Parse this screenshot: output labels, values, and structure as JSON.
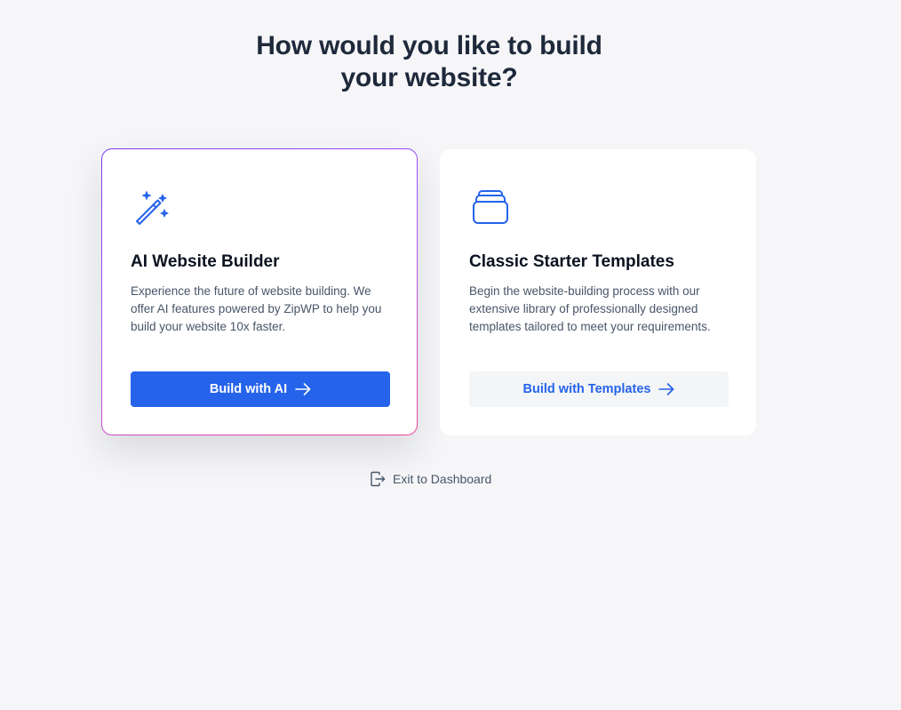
{
  "heading": {
    "line1": "How would you like to build",
    "line2": "your website?"
  },
  "cards": {
    "ai": {
      "icon": "magic-wand-icon",
      "title": "AI Website Builder",
      "description": "Experience the future of website building. We offer AI features powered by ZipWP to help you build your website 10x faster.",
      "button_label": "Build with AI",
      "button_icon": "arrow-right-icon",
      "selected": true
    },
    "templates": {
      "icon": "stacked-layers-icon",
      "title": "Classic Starter Templates",
      "description": "Begin the website-building process with our extensive library of professionally designed templates tailored to meet your requirements.",
      "button_label": "Build with Templates",
      "button_icon": "arrow-right-icon",
      "selected": false
    }
  },
  "footer": {
    "exit_label": "Exit to Dashboard",
    "exit_icon": "exit-door-icon"
  },
  "colors": {
    "accent": "#2563eb",
    "background": "#f6f6f8",
    "selected_border_start": "#7c3aed",
    "selected_border_end": "#ec4899"
  }
}
